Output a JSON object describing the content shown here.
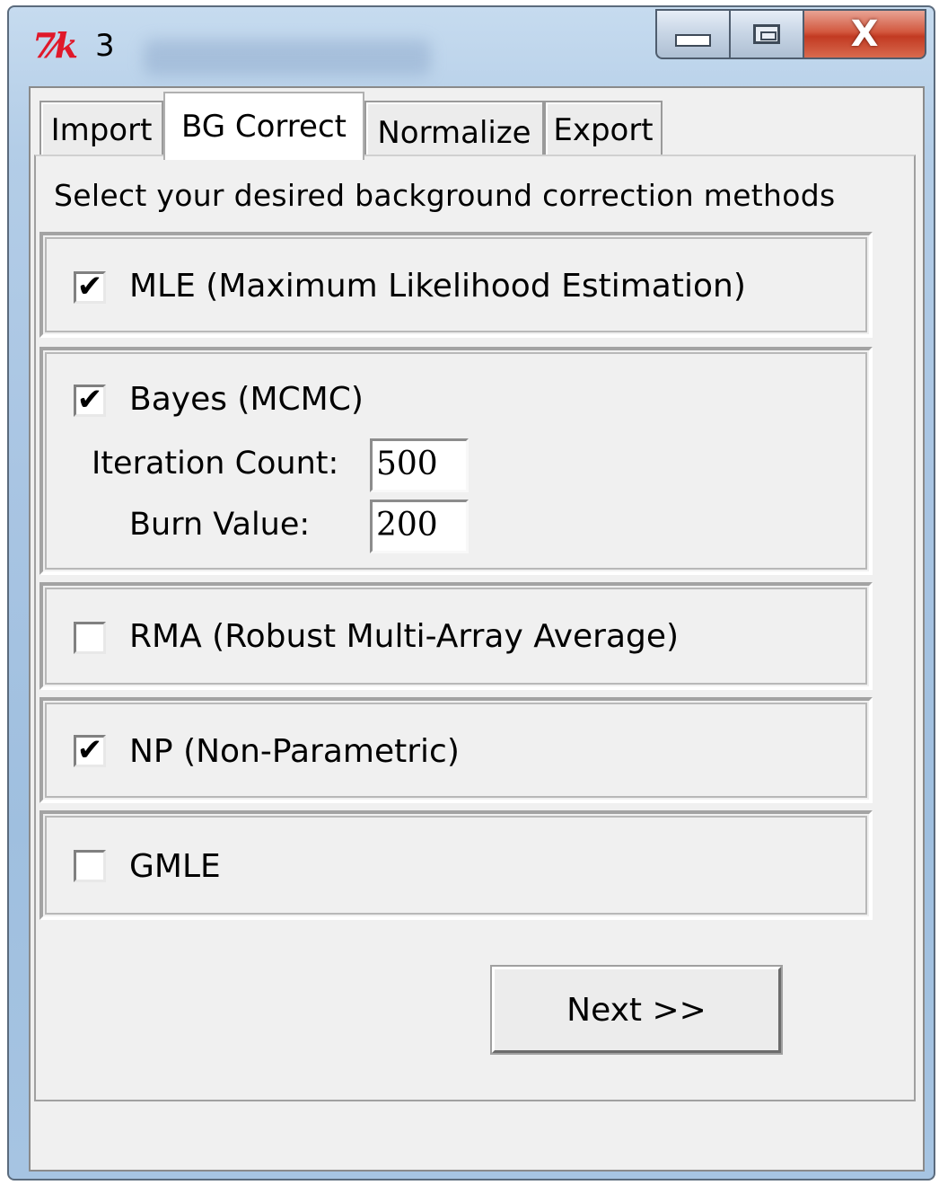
{
  "window": {
    "title": "3",
    "app_icon_text": "7⁄k",
    "icon": "tk-feather-icon",
    "controls": {
      "minimize_icon": "minimize-icon",
      "maximize_icon": "maximize-icon",
      "close_glyph": "X"
    }
  },
  "tabs": [
    {
      "label": "Import",
      "active": false
    },
    {
      "label": "BG Correct",
      "active": true
    },
    {
      "label": "Normalize",
      "active": false
    },
    {
      "label": "Export",
      "active": false
    }
  ],
  "panel": {
    "instruction": "Select your desired background correction methods",
    "options": [
      {
        "label": "MLE (Maximum Likelihood Estimation)",
        "checked": true
      },
      {
        "label": "Bayes (MCMC)",
        "checked": true,
        "fields": [
          {
            "label": "Iteration Count:",
            "value": "500"
          },
          {
            "label": "Burn Value:",
            "value": "200"
          }
        ]
      },
      {
        "label": "RMA (Robust Multi-Array Average)",
        "checked": false
      },
      {
        "label": "NP (Non-Parametric)",
        "checked": true
      },
      {
        "label": "GMLE",
        "checked": false
      }
    ],
    "check_mark": "✔",
    "next_label": "Next >>"
  },
  "colors": {
    "window_frame": "#a9c5e3",
    "close_button": "#c23a22",
    "app_icon": "#e0182a",
    "panel_bg": "#f0f0f0"
  }
}
